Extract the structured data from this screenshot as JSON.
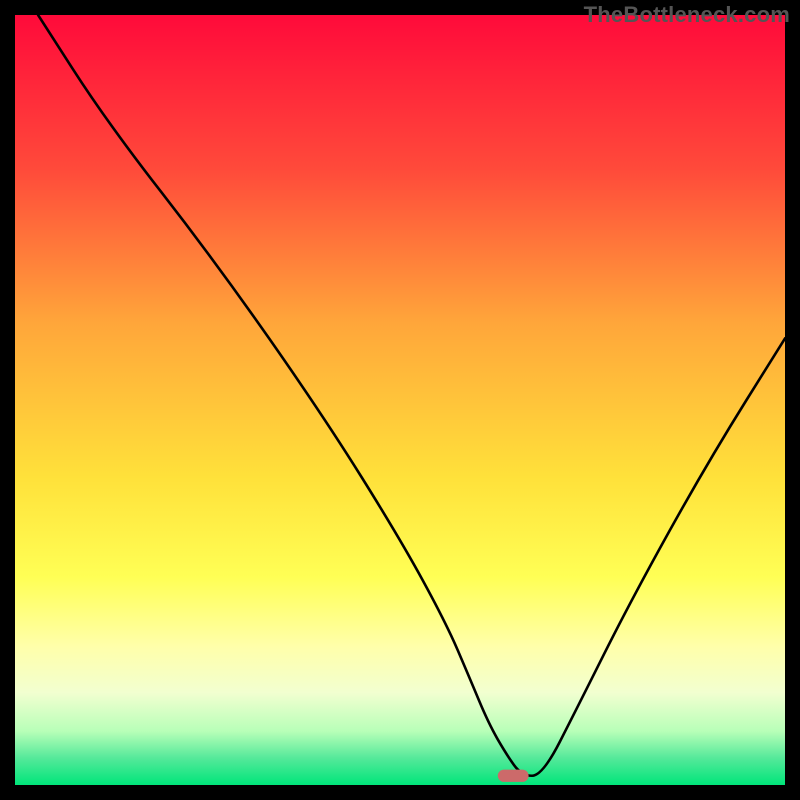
{
  "watermark": "TheBottleneck.com",
  "chart_data": {
    "type": "line",
    "title": "",
    "xlabel": "",
    "ylabel": "",
    "xlim": [
      0,
      100
    ],
    "ylim": [
      0,
      100
    ],
    "gradient_stops": [
      {
        "offset": 0.0,
        "color": "#ff0a3a"
      },
      {
        "offset": 0.2,
        "color": "#ff4a3a"
      },
      {
        "offset": 0.4,
        "color": "#ffa63a"
      },
      {
        "offset": 0.6,
        "color": "#ffe13a"
      },
      {
        "offset": 0.73,
        "color": "#ffff55"
      },
      {
        "offset": 0.82,
        "color": "#ffffaa"
      },
      {
        "offset": 0.88,
        "color": "#f2ffd0"
      },
      {
        "offset": 0.93,
        "color": "#b8ffb8"
      },
      {
        "offset": 0.965,
        "color": "#55e99a"
      },
      {
        "offset": 1.0,
        "color": "#00e57a"
      }
    ],
    "series": [
      {
        "name": "bottleneck-curve",
        "x": [
          3,
          12,
          26,
          40,
          50,
          56,
          59,
          61.5,
          63.8,
          65.8,
          68.5,
          73,
          80,
          90,
          100
        ],
        "y": [
          100,
          86,
          68,
          48,
          32,
          21,
          14,
          8,
          4,
          1.2,
          1.2,
          10,
          24,
          42,
          58
        ]
      }
    ],
    "marker": {
      "name": "sweet-spot-marker",
      "x": 64.7,
      "y": 1.2,
      "color": "#cc6a6a",
      "width_pct": 4.0,
      "height_pct": 1.6
    }
  }
}
